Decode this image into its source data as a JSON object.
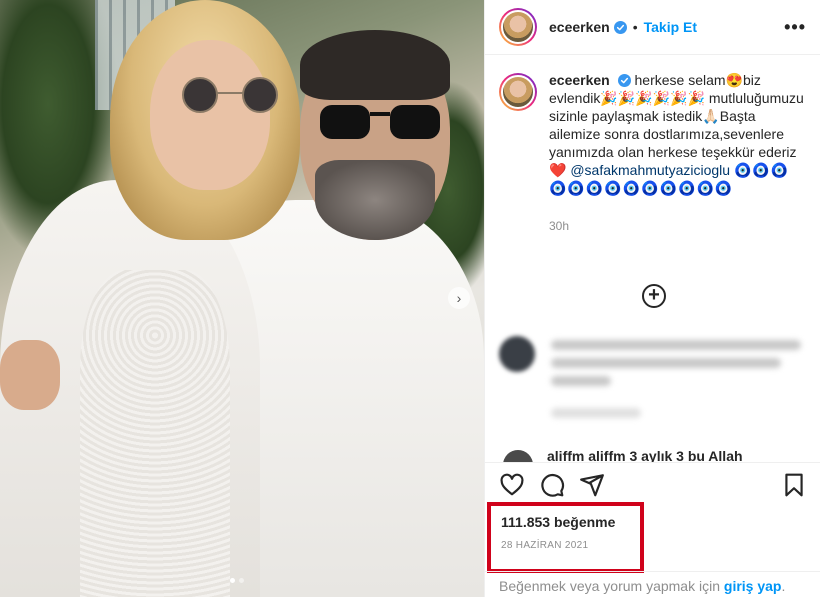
{
  "post": {
    "username": "eceerken",
    "follow_label": "Takip Et",
    "more_label": "•••",
    "separator": "•",
    "caption": {
      "username": "eceerken",
      "text_1": "herkese selam",
      "emoji_1": "😍",
      "text_2": "biz evlendik",
      "emoji_2": "🎉🎉🎉🎉🎉🎉",
      "text_3": "mutluluğumuzu sizinle paylaşmak istedik",
      "emoji_3": "🙏🏻",
      "text_4": "Başta ailemize sonra dostlarımıza,sevenlere yanımızda olan herkese teşekkür ederiz",
      "emoji_4": "❤️",
      "mention": "@safakmahmutyazicioglu",
      "evil_eyes": "🧿🧿🧿🧿🧿🧿🧿🧿🧿🧿🧿🧿🧿"
    },
    "time_ago": "30h",
    "load_more": "+",
    "partial_comment": "aliffm aliffm 3 aylık 3 bu Allah",
    "likes": "111.853 beğenme",
    "date": "28 HAZİRAN 2021",
    "login_prompt": "Beğenmek veya yorum yapmak için",
    "login_link": "giriş yap",
    "login_suffix": ".",
    "carousel_next": "›"
  },
  "icons": {
    "verified": "verified-badge-icon",
    "like": "heart-icon",
    "comment": "comment-icon",
    "share": "share-icon",
    "save": "bookmark-icon",
    "add": "plus-circle-icon"
  },
  "colors": {
    "accent": "#0095f6",
    "highlight": "#d0021b",
    "muted": "#8e8e8e",
    "text": "#262626"
  }
}
